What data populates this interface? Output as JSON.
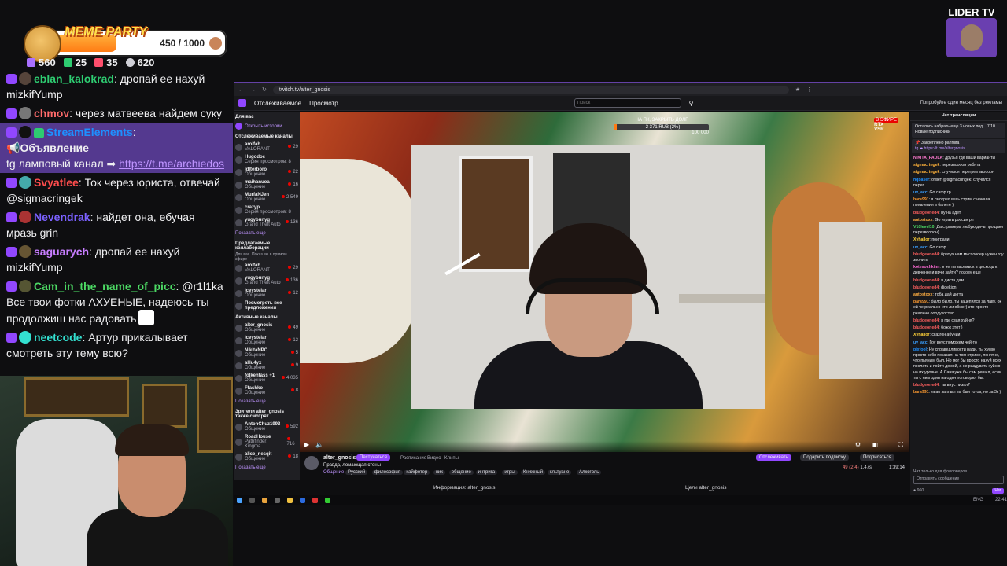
{
  "overlay": {
    "meme_party": {
      "title": "MEME PARTY",
      "count": "450 / 1000",
      "progress": 0.45
    },
    "stats": [
      {
        "name": "viewers",
        "value": "560",
        "color": "#a970ff"
      },
      {
        "name": "followers",
        "value": "25",
        "color": "#2ecc71"
      },
      {
        "name": "subs",
        "value": "35",
        "color": "#ff4f6d"
      },
      {
        "name": "bits",
        "value": "620",
        "color": "#cfcfd6"
      }
    ],
    "lider": {
      "label": "LIDER TV"
    }
  },
  "chat": [
    {
      "user": "eblan_kalokrad",
      "color": "#2ecc71",
      "sep": ": ",
      "text": "дропай ее нахуй mizkifYump"
    },
    {
      "user": "chmov",
      "color": "#ff6b6b",
      "sep": ": ",
      "text": "через матвеева найдем суку"
    },
    {
      "user": "StreamElements",
      "color": "#1e90ff",
      "sep": ":",
      "announce": "Объявление",
      "text": "tg ламповый канал ➡ ",
      "link": "https://t.me/archiedos"
    },
    {
      "user": "Svyatlee",
      "color": "#ff4d4d",
      "sep": ": ",
      "text": "Ток через юриста, отвечай @sigmacringek"
    },
    {
      "user": "Nevendrak",
      "color": "#7b61ff",
      "sep": ": ",
      "text": "найдет она, ебучая мразь grin"
    },
    {
      "user": "saguarych",
      "color": "#c77dff",
      "sep": ": ",
      "text": "дропай ее нахуй mizkifYump"
    },
    {
      "user": "Cam_in_the_name_of_picc",
      "color": "#4cd964",
      "sep": ": ",
      "text": "@r1l1ka Все твои фотки АХУЕНЫЕ, надеюсь ты продолжиш нас радовать"
    },
    {
      "user": "neetcode",
      "color": "#33e0d0",
      "sep": ": ",
      "text": "Артур прикалывает смотреть эту тему всю?"
    }
  ],
  "browser": {
    "url": "twitch.tv/alter_gnosis",
    "nav": {
      "following": "Отслеживаемое",
      "browse": "Просмотр",
      "search_placeholder": "Поиск",
      "promo": "Попробуйте один месяц без рекламы"
    },
    "sidebar": {
      "for_you": "Для вас",
      "history": "Открыть истории",
      "followed_header": "Отслеживаемые каналы",
      "followed": [
        {
          "name": "arolfah",
          "game": "VALORANT",
          "viewers": "29"
        },
        {
          "name": "Hugodoc",
          "game": "Серия просмотров: 8",
          "viewers": ""
        },
        {
          "name": "ldlterboro",
          "game": "Общение",
          "viewers": "22"
        },
        {
          "name": "maihanuoa",
          "game": "Общение",
          "viewers": "16"
        },
        {
          "name": "MurfaNJen",
          "game": "Общение",
          "viewers": "2 549"
        },
        {
          "name": "crazyp",
          "game": "Серия просмотров: 8",
          "viewers": ""
        },
        {
          "name": "yugybunyg",
          "game": "Grand Theft Auto",
          "viewers": "136"
        }
      ],
      "show_more": "Показать еще",
      "collab_header": "Предлагаемые коллаборации",
      "collab_sub": "Для вас. Показ вы в прямом эфире",
      "collab": [
        {
          "name": "arolfah",
          "game": "VALORANT",
          "viewers": "29"
        },
        {
          "name": "yugybunyg",
          "game": "Grand Theft Auto",
          "viewers": "136"
        },
        {
          "name": "iceystelar",
          "game": "Общение",
          "viewers": "12"
        },
        {
          "name": "Посмотреть все предложения",
          "game": "",
          "viewers": ""
        }
      ],
      "active_header": "Активные каналы",
      "active": [
        {
          "name": "alter_gnosis",
          "game": "Общение",
          "viewers": "49"
        },
        {
          "name": "iceystelar",
          "game": "Общение",
          "viewers": "12"
        },
        {
          "name": "NikitaNPC",
          "game": "Общение",
          "viewers": "5"
        },
        {
          "name": "aHu4yx",
          "game": "Общение",
          "viewers": "9"
        },
        {
          "name": "folkentass +1",
          "game": "Общение",
          "viewers": "4 035"
        },
        {
          "name": "Ffashko",
          "game": "Общение",
          "viewers": "8"
        }
      ],
      "show_more2": "Показать еще",
      "viewers_header": "Зрители alter_gnosis также смотрят",
      "viewers_also": [
        {
          "name": "AntonChuz1993",
          "game": "Общение",
          "viewers": "592"
        },
        {
          "name": "RoadHouse",
          "game": "Pathfinder: Kingma...",
          "viewers": "716"
        },
        {
          "name": "alice_nesqit",
          "game": "Общение",
          "viewers": "18"
        }
      ],
      "show_more3": "Показать еще"
    },
    "video": {
      "goal_label": "НА ПК, ЗАКРЫТЬ ДОЛГ",
      "goal_value": "2 371 RUB (2%)",
      "goal_end": "100 000",
      "goal_progress": 0.02,
      "live_badge": "В ЭФИРЕ",
      "live_tags": [
        "RTX",
        "VSR"
      ]
    },
    "stream": {
      "channel": "alter_gnosis",
      "follow": "Пестучаться",
      "schedule": "Расписание",
      "videos": "Видео",
      "clips": "Клипы",
      "title": "Правда, ломающая стены",
      "live": "В ЭФИРЕ",
      "category": "Общение",
      "tags": [
        "Русский",
        "философия",
        "кайфотер",
        "ник",
        "общение",
        "интрига",
        "игры",
        "Книжный",
        "кльтуане",
        "Алкоголь"
      ],
      "follow_btn": "Отслеживать",
      "gift_btn": "Подарить подписку",
      "sub_btn": "Подписаться",
      "viewers": "49 (2.4)",
      "uptime": "1.47s",
      "time": "1:39:14",
      "info_label": "Информация: alter_gnosis",
      "goals_label": "Цели alter_gnosis"
    },
    "tchat": {
      "header": "Чат трансляции",
      "subs_notice": "Осталось набрать еще 3 новых под... 7/10 Новые подписчики",
      "pinned_label": "Закреплено",
      "pinned_user": "pahfulfa",
      "pinned_text": "tg ➡ https://t.me/altergnosis",
      "messages": [
        {
          "user": "NIKITA_PADLA",
          "color": "#ff7bd1",
          "text": "друзья где ваши варианты"
        },
        {
          "user": "sigmacringek",
          "color": "#ffb23a",
          "text": "перезвоооон ребята"
        },
        {
          "user": "sigmacringek",
          "color": "#ffb23a",
          "text": "случился перегрев звоооон"
        },
        {
          "user": "hqbaser",
          "color": "#1e90ff",
          "text": "ответ @sigmacringek: случился перег..."
        },
        {
          "user": "uv_acc",
          "color": "#3aa0ff",
          "text": "Go camp rp"
        },
        {
          "user": "bars991",
          "color": "#ff9b30",
          "text": "я смотрел весь стрим с начала появления в балете )"
        },
        {
          "user": "bludgeoned4",
          "color": "#ff5f5f",
          "text": "ну на адет"
        },
        {
          "user": "autostoxx",
          "color": "#ffae42",
          "text": "Go играть россия рп"
        },
        {
          "user": "V10level10",
          "color": "#4cd964",
          "text": "Да стримеры любую дичь прощают перезвоооон)"
        },
        {
          "user": "Xvhailor",
          "color": "#ffd23a",
          "text": "поиграли"
        },
        {
          "user": "uv_acc",
          "color": "#3aa0ff",
          "text": "Go camp"
        },
        {
          "user": "bludgeoned4",
          "color": "#ff5f5f",
          "text": "братух нам миссоооер нужен гоу звонить"
        },
        {
          "user": "kotesochkinn",
          "color": "#ff6bd6",
          "text": "и че ты засемьок в дискорд к девченке и врчи зайти? позову еще"
        },
        {
          "user": "bludgeoned4",
          "color": "#ff5f5f",
          "text": "я диста дам"
        },
        {
          "user": "bludgeoned4",
          "color": "#ff5f5f",
          "text": "digekion"
        },
        {
          "user": "autostoxx",
          "color": "#ffae42",
          "text": "тоба дай дигта"
        },
        {
          "user": "bars991",
          "color": "#ff9b30",
          "text": "было было, ты зацепился за лаву, ок ей че реально что ли обжег) это просто реально ооодухоство"
        },
        {
          "user": "bludgeoned4",
          "color": "#ff5f5f",
          "text": "я где свая хуйня?"
        },
        {
          "user": "bludgeoned4",
          "color": "#ff5f5f",
          "text": "божж этот )"
        },
        {
          "user": "Xvhailor",
          "color": "#ffd23a",
          "text": "сказгон абучий"
        },
        {
          "user": "uv_acc",
          "color": "#3aa0ff",
          "text": "Гоу внус поможем чей-то"
        },
        {
          "user": "pixfool",
          "color": "#1e90ff",
          "text": "Ну справедливости ради, ты хуево просто себя показал на том стриме, понятно, что пьяным был. Но мог бы просто нахуй всех послать и пойти домой, а не раздувать хуйню на их уровне. А Саня уже бы сам решил, если ты с ним один на один поговорил бы."
        },
        {
          "user": "bludgeoned4",
          "color": "#ff5f5f",
          "text": "ты внус лизал?"
        },
        {
          "user": "bars991",
          "color": "#ff9b30",
          "text": "лиао заплыл ты был готов, но за 3к )"
        }
      ],
      "followers_only": "Чат только для фолловеров",
      "input_placeholder": "Отправить сообщение",
      "points": "960",
      "chat_btn": "Чат"
    },
    "taskbar": {
      "lang": "ENG",
      "clock": "22:41"
    }
  }
}
